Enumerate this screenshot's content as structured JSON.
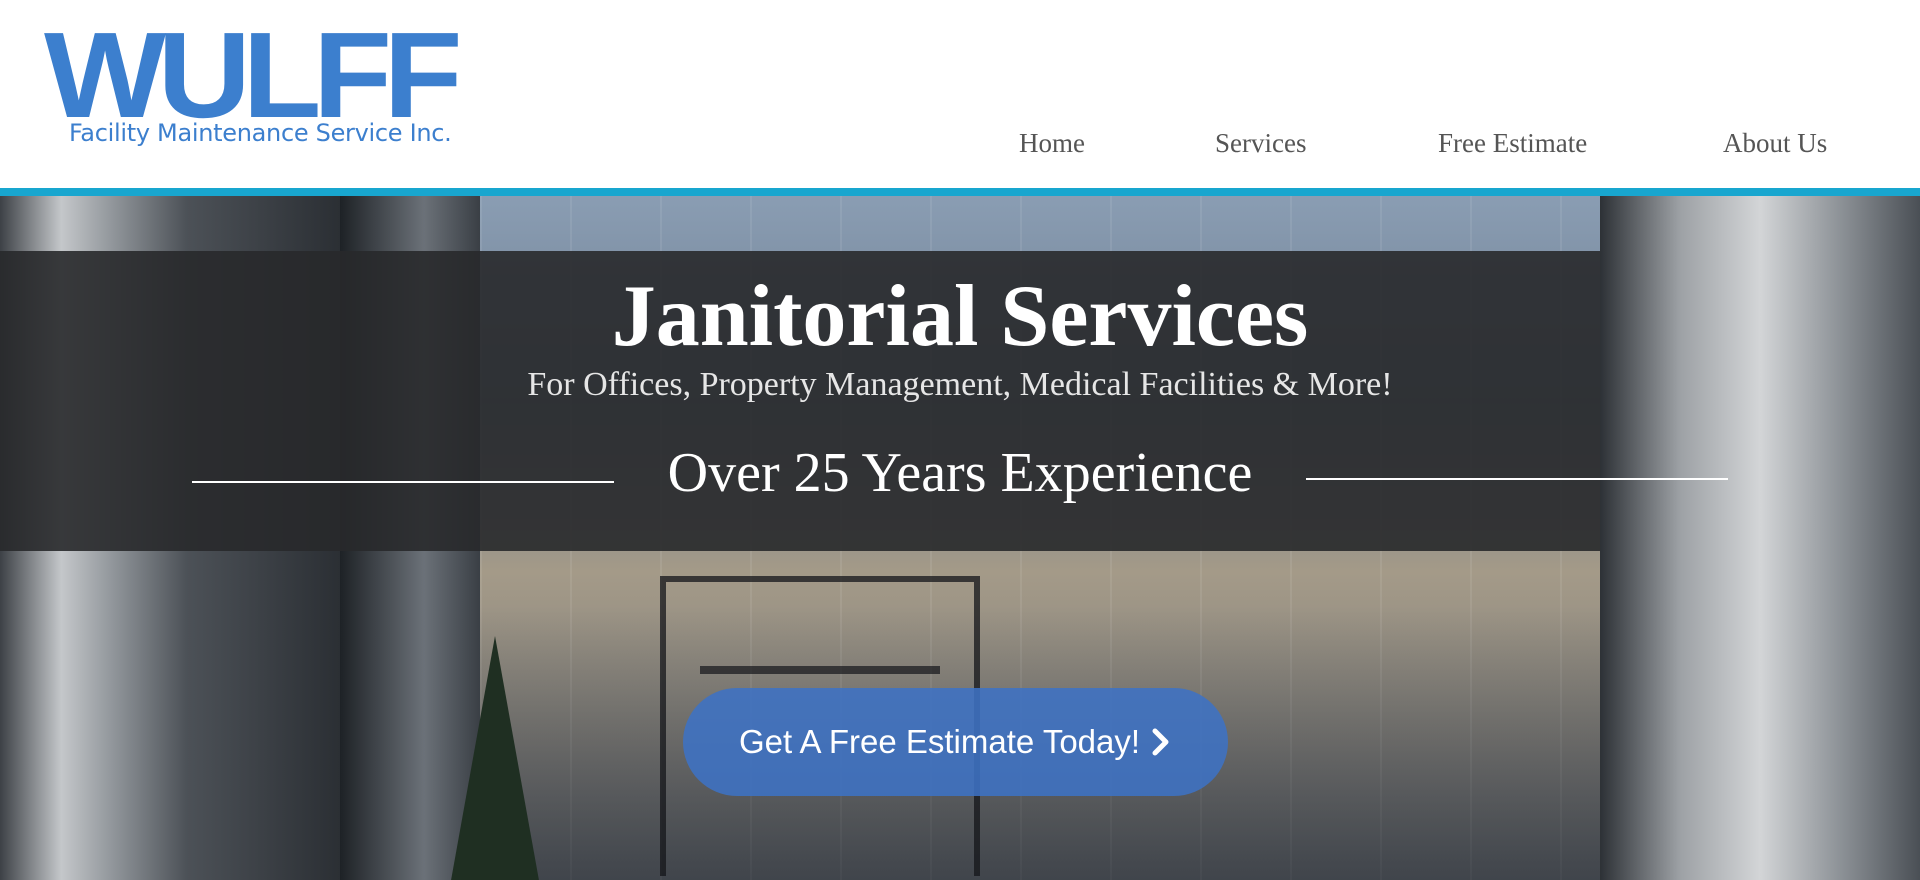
{
  "header": {
    "logo": {
      "wordmark": "WULFF",
      "tagline": "Facility Maintenance Service Inc."
    },
    "nav": [
      {
        "label": "Home"
      },
      {
        "label": "Services"
      },
      {
        "label": "Free Estimate"
      },
      {
        "label": "About Us"
      }
    ],
    "rule_color": "#18a6cf"
  },
  "hero": {
    "title": "Janitorial Services",
    "subtitle": "For Offices, Property Management, Medical Facilities & More!",
    "experience": "Over 25 Years Experience",
    "cta": {
      "label": "Get A Free Estimate Today!",
      "icon": "chevron-right-icon",
      "color": "#3e72c4"
    }
  },
  "colors": {
    "brand": "#3c7fce",
    "accent": "#18a6cf",
    "nav_text": "#555555"
  }
}
